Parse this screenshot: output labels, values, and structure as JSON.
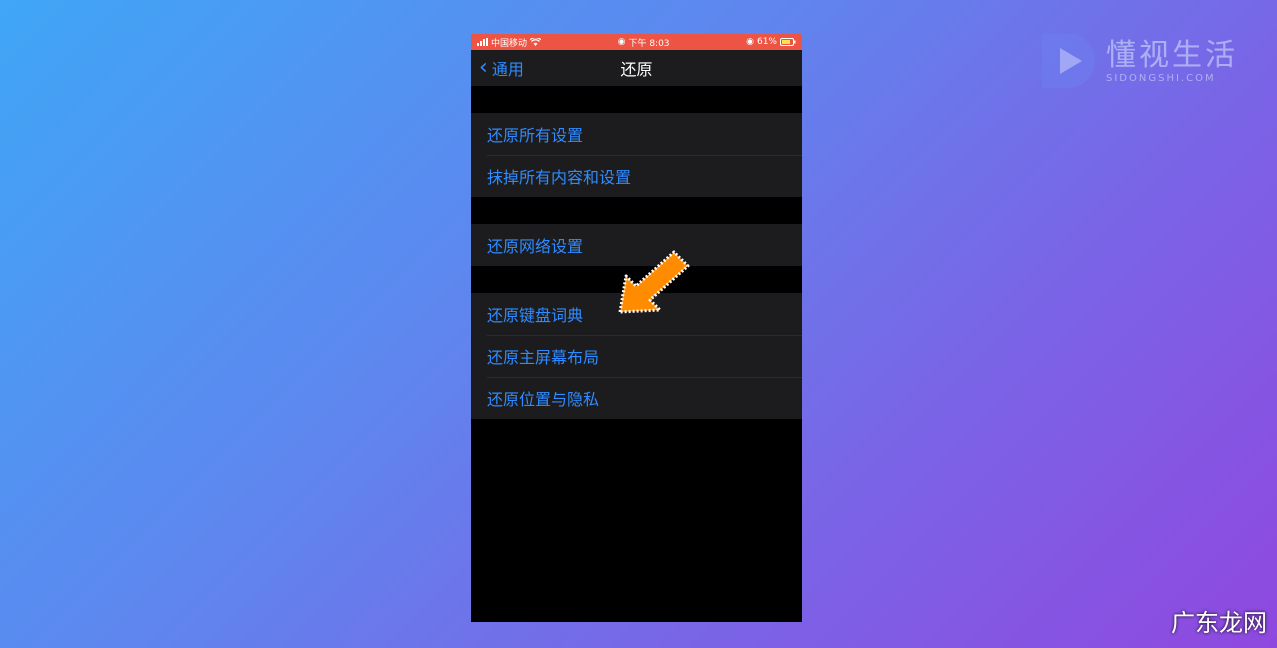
{
  "status_bar": {
    "carrier": "中国移动",
    "time": "下午 8:03",
    "battery": "61%"
  },
  "nav": {
    "back_label": "通用",
    "title": "还原"
  },
  "groups": [
    [
      "还原所有设置",
      "抹掉所有内容和设置"
    ],
    [
      "还原网络设置"
    ],
    [
      "还原键盘词典",
      "还原主屏幕布局",
      "还原位置与隐私"
    ]
  ],
  "watermark_logo": {
    "cn": "懂视生活",
    "en": "SIDONGSHI.COM"
  },
  "watermark_bottom": "广东龙网",
  "colors": {
    "accent": "#2f8bff",
    "status_bar": "#ee5444",
    "arrow": "#ff8c00"
  }
}
